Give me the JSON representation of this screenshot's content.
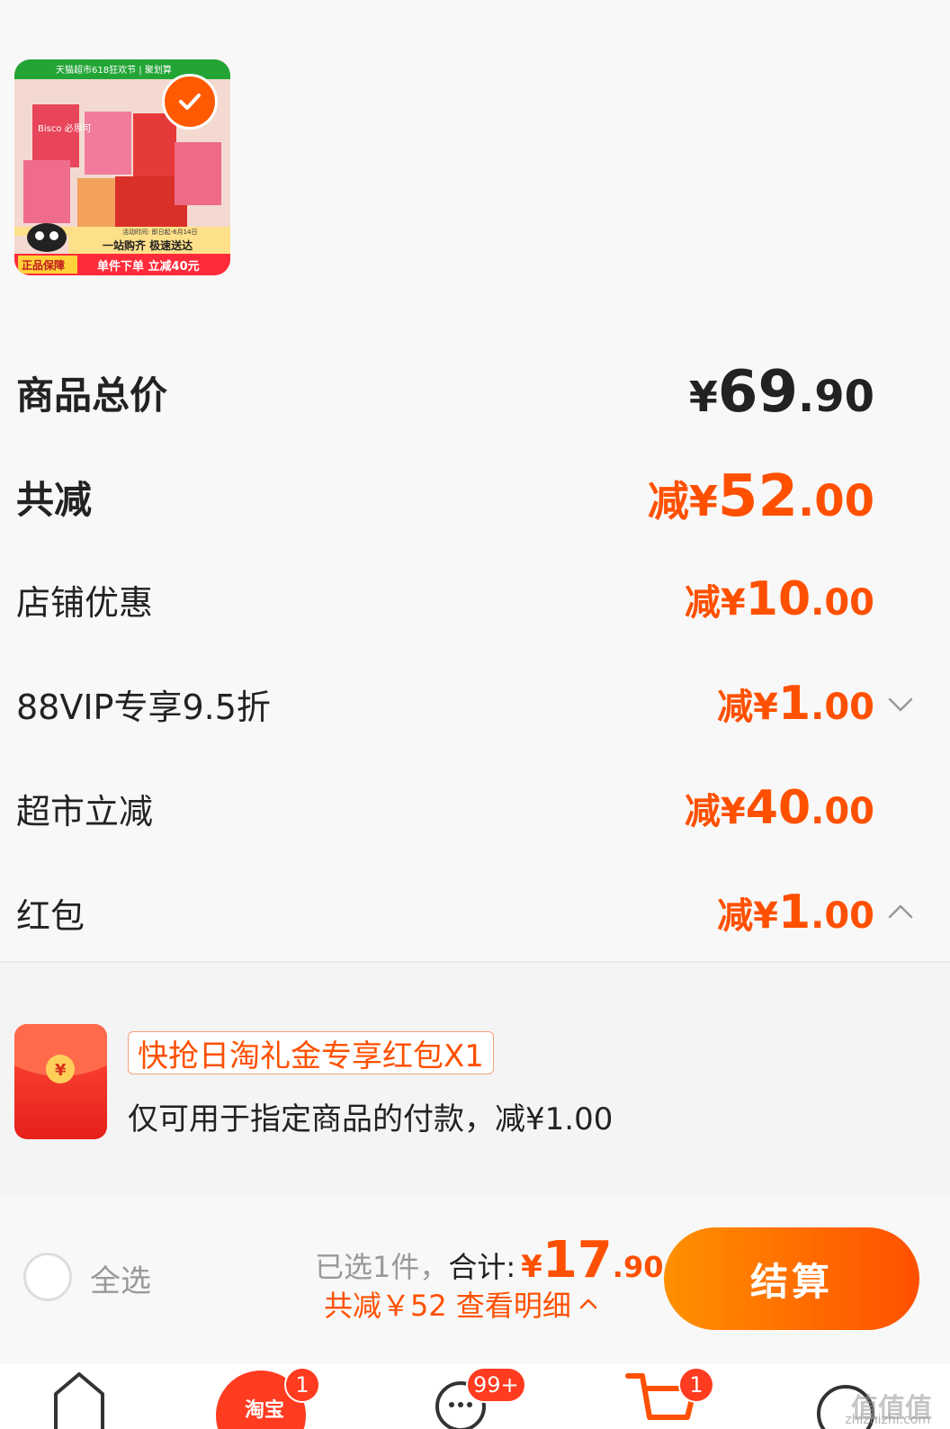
{
  "product": {
    "banner_top": "天猫超市618狂欢节 | 聚划算",
    "brand": "Bisco 必思可",
    "activity_time": "活动时间: 即日起-6月14日",
    "slogan": "一站购齐 极速送达",
    "guarantee": "正品保障",
    "promo": "单件下单 立减40元"
  },
  "summary": {
    "total_label": "商品总价",
    "total_prefix": "¥",
    "total_int": "69",
    "total_dec": ".90",
    "reduce_label": "共减",
    "reduce_prefix": "减¥",
    "reduce_int": "52",
    "reduce_dec": ".00"
  },
  "discounts": [
    {
      "label": "店铺优惠",
      "prefix": "减¥",
      "int": "10",
      "dec": ".00"
    },
    {
      "label": "88VIP专享9.5折",
      "prefix": "减¥",
      "int": "1",
      "dec": ".00"
    },
    {
      "label": "超市立减",
      "prefix": "减¥",
      "int": "40",
      "dec": ".00"
    },
    {
      "label": "红包",
      "prefix": "减¥",
      "int": "1",
      "dec": ".00"
    }
  ],
  "coupon": {
    "tag": "快抢日淘礼金专享红包X1",
    "desc": "仅可用于指定商品的付款，减¥1.00"
  },
  "footer": {
    "select_all": "全选",
    "selected": "已选1件，",
    "total_label": "合计:",
    "yen": "¥",
    "total_int": "17",
    "total_dec": ".90",
    "savings": "共减￥52 查看明细"
  },
  "checkout": "结算",
  "tabs": [
    {
      "name": "home",
      "badge": ""
    },
    {
      "name": "taobao",
      "label": "淘宝",
      "badge": "1"
    },
    {
      "name": "messages",
      "badge": "99+"
    },
    {
      "name": "cart",
      "badge": "1"
    },
    {
      "name": "me",
      "badge": ""
    }
  ],
  "watermark": {
    "text": "值值值",
    "url": "zhizhizhi.com"
  },
  "colors": {
    "accent": "#ff5000",
    "checkout_gradient": [
      "#ff9000",
      "#ff5000"
    ]
  }
}
